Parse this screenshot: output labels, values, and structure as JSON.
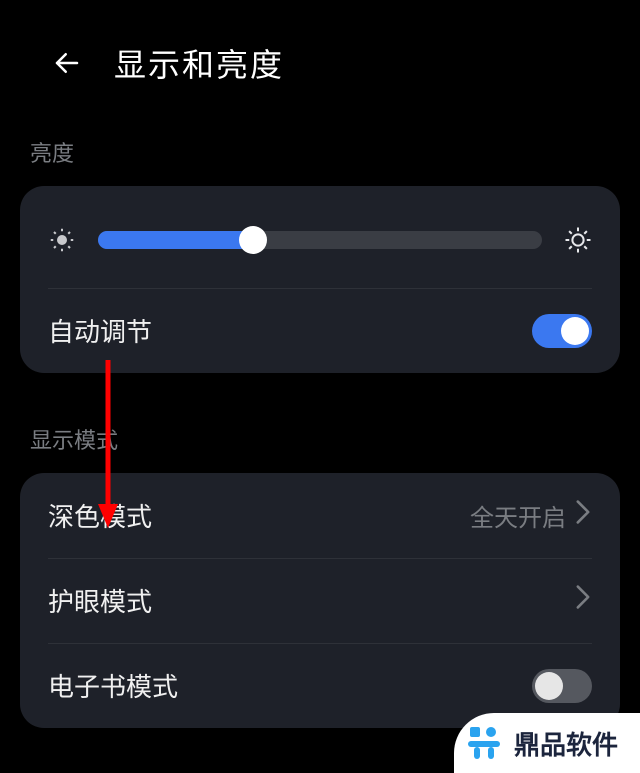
{
  "header": {
    "title": "显示和亮度"
  },
  "brightness": {
    "section_label": "亮度",
    "slider_percent": 35,
    "auto_label": "自动调节",
    "auto_on": true
  },
  "display_mode": {
    "section_label": "显示模式",
    "dark_mode": {
      "label": "深色模式",
      "value": "全天开启"
    },
    "eye_care": {
      "label": "护眼模式"
    },
    "ebook": {
      "label": "电子书模式",
      "on": false
    }
  },
  "watermark": {
    "text": "鼎品软件"
  }
}
